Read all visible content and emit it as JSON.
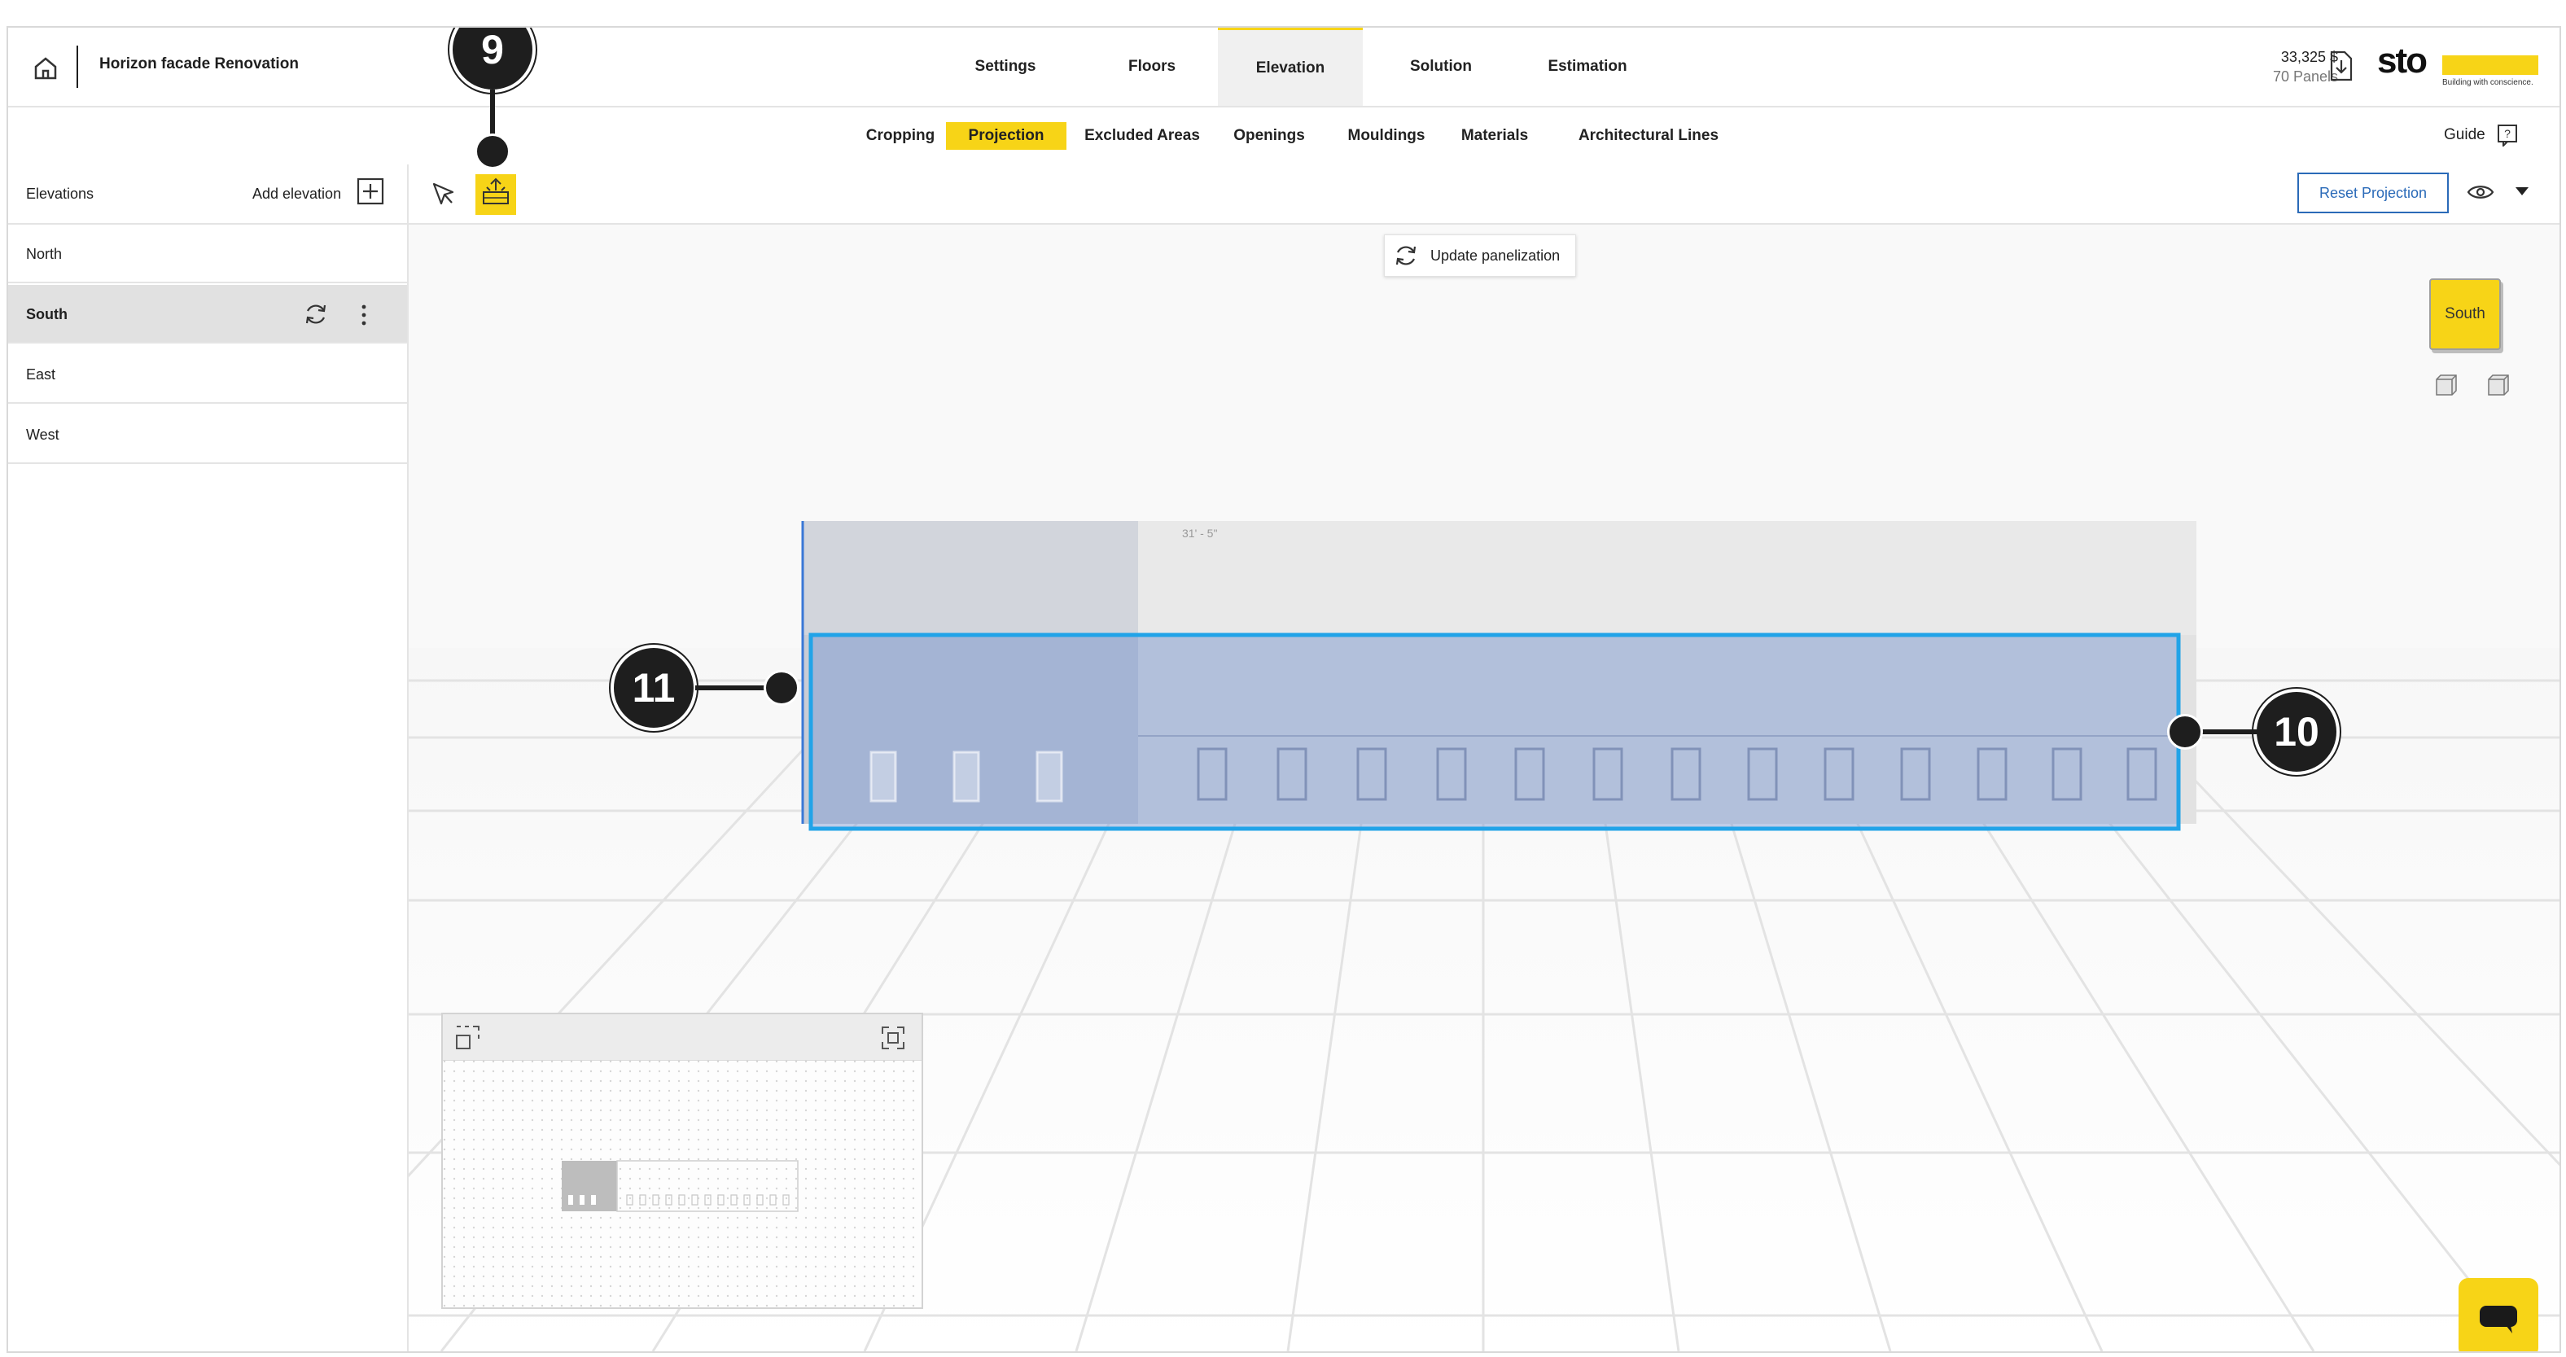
{
  "app": {
    "project_title": "Horizon facade Renovation",
    "price": "33,325 $",
    "panels": "70 Panels",
    "brand": "sto",
    "brand_tagline": "Building with conscience.",
    "accent_color": "#f7d417",
    "link_color": "#2a6ab8"
  },
  "main_tabs": [
    {
      "label": "Settings",
      "active": false
    },
    {
      "label": "Floors",
      "active": false
    },
    {
      "label": "Elevation",
      "active": true
    },
    {
      "label": "Solution",
      "active": false
    },
    {
      "label": "Estimation",
      "active": false
    }
  ],
  "sub_tabs": [
    {
      "label": "Cropping",
      "active": false
    },
    {
      "label": "Projection",
      "active": true
    },
    {
      "label": "Excluded Areas",
      "active": false
    },
    {
      "label": "Openings",
      "active": false
    },
    {
      "label": "Mouldings",
      "active": false
    },
    {
      "label": "Materials",
      "active": false
    },
    {
      "label": "Architectural Lines",
      "active": false
    }
  ],
  "guide_label": "Guide",
  "sidebar": {
    "header": "Elevations",
    "add_label": "Add elevation",
    "items": [
      {
        "label": "North",
        "active": false
      },
      {
        "label": "South",
        "active": true
      },
      {
        "label": "East",
        "active": false
      },
      {
        "label": "West",
        "active": false
      }
    ]
  },
  "toolbar": {
    "reset_label": "Reset Projection",
    "tools": [
      "select-cursor-icon",
      "projection-tool-icon"
    ]
  },
  "canvas": {
    "update_label": "Update panelization",
    "view_cube_label": "South",
    "dimension_text": "31' - 5\""
  },
  "callouts": {
    "nine": "9",
    "ten": "10",
    "eleven": "11"
  },
  "icons": [
    "home-icon",
    "download-icon",
    "help-icon",
    "add-icon",
    "refresh-icon",
    "kebab-icon",
    "eye-icon",
    "caret-down-icon",
    "fit-view-icon",
    "expand-icon",
    "chat-icon"
  ]
}
